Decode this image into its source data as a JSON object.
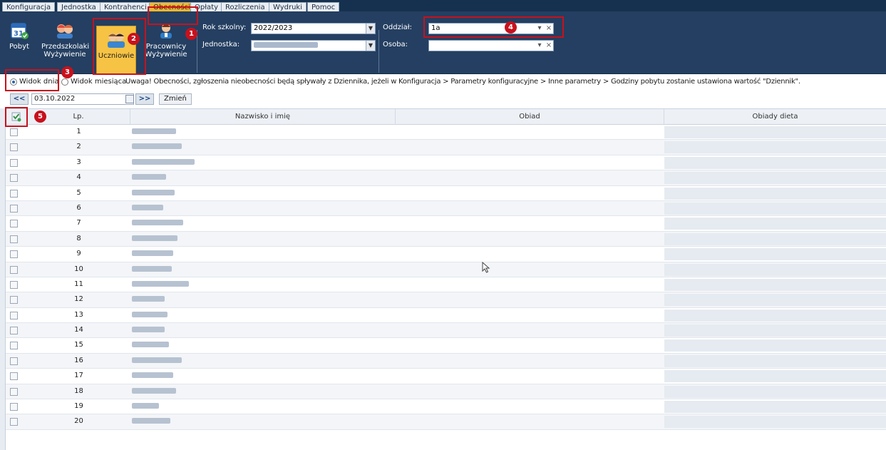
{
  "menu": [
    "Konfiguracja",
    "Jednostka",
    "Kontrahenci",
    "Obecności",
    "Opłaty",
    "Rozliczenia",
    "Wydruki",
    "Pomoc"
  ],
  "menu_active": "Obecności",
  "toolbar": {
    "pobyt": "Pobyt",
    "przedszkolaki_l1": "Przedszkolaki",
    "przedszkolaki_l2": "Wyżywienie",
    "uczniowie": "Uczniowie",
    "pracownicy_l1": "Pracownicy",
    "pracownicy_l2": "Wyżywienie",
    "calendar_day": "31"
  },
  "filters": {
    "rok_label": "Rok szkolny:",
    "rok_value": "2022/2023",
    "jednostka_label": "Jednostka:",
    "oddzial_label": "Oddział:",
    "oddzial_value": "1a",
    "osoba_label": "Osoba:",
    "osoba_value": ""
  },
  "view": {
    "day": "Widok dnia",
    "month": "Widok miesiąca",
    "selected": "day",
    "notice": "Uwaga! Obecności, zgłoszenia nieobecności będą spływały z Dziennika, jeżeli w Konfiguracja > Parametry konfiguracyjne > Inne parametry > Godziny pobytu zostanie ustawiona wartość \"Dziennik\"."
  },
  "datebar": {
    "prev": "<<",
    "date": "03.10.2022",
    "next": ">>",
    "change": "Zmień"
  },
  "table": {
    "columns": [
      "Lp.",
      "Nazwisko i imię",
      "Obiad",
      "Obiady dieta"
    ],
    "rows": [
      "1",
      "2",
      "3",
      "4",
      "5",
      "6",
      "7",
      "8",
      "9",
      "10",
      "11",
      "12",
      "13",
      "14",
      "15",
      "16",
      "17",
      "18",
      "19",
      "20"
    ]
  },
  "annotations": [
    "1",
    "2",
    "3",
    "4",
    "5"
  ],
  "colors": {
    "header": "#15314f",
    "ribbon": "#243f61",
    "active": "#f7b731",
    "annotation": "#c8111d"
  }
}
